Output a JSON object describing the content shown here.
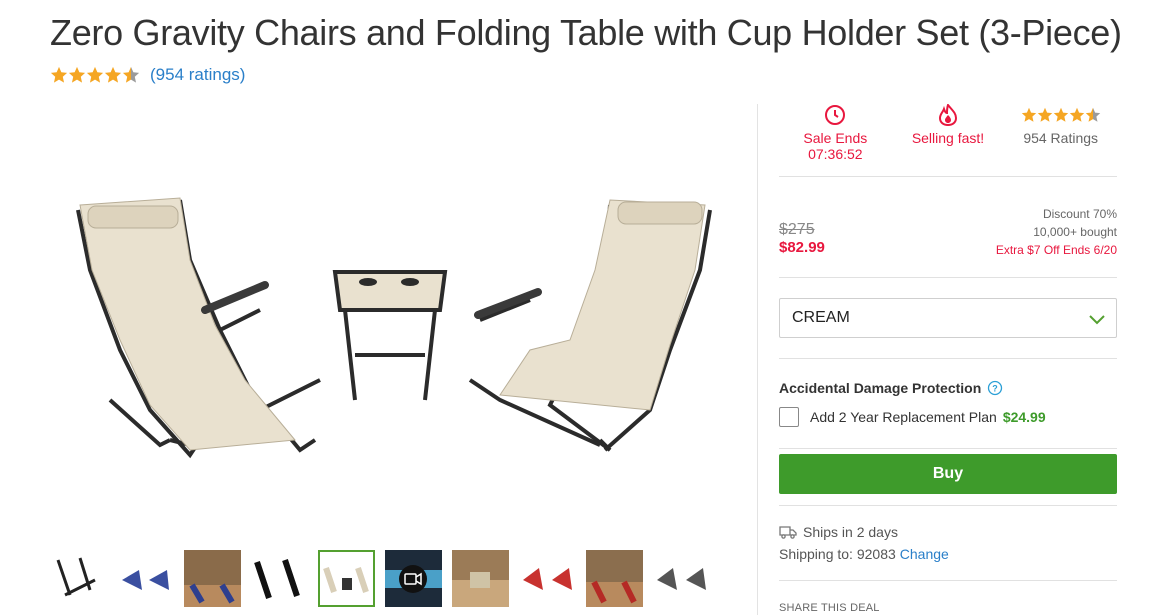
{
  "product": {
    "title": "Zero Gravity Chairs and Folding Table with Cup Holder Set (3-Piece)",
    "rating": 4.5,
    "ratings_link": "(954 ratings)"
  },
  "badges": {
    "sale_label": "Sale Ends",
    "sale_timer": "07:36:52",
    "selling_fast": "Selling fast!",
    "ratings": "954 Ratings"
  },
  "price": {
    "original": "$275",
    "sale": "$82.99",
    "discount": "Discount 70%",
    "bought": "10,000+ bought",
    "extra_off": "Extra $7 Off Ends 6/20"
  },
  "variant": {
    "selected": "CREAM"
  },
  "protection": {
    "title": "Accidental Damage Protection",
    "plan_label": "Add 2 Year Replacement Plan",
    "plan_price": "$24.99"
  },
  "actions": {
    "buy_label": "Buy"
  },
  "shipping": {
    "ships_in": "Ships in 2 days",
    "shipping_to_label": "Shipping to: 92083",
    "change_label": "Change"
  },
  "share": {
    "label": "SHARE THIS DEAL"
  },
  "thumbnails": [
    {
      "name": "thumb-1",
      "kind": "black-chairs-mixed"
    },
    {
      "name": "thumb-2",
      "kind": "blue-chairs"
    },
    {
      "name": "thumb-3",
      "kind": "blue-patio"
    },
    {
      "name": "thumb-4",
      "kind": "black-chairs"
    },
    {
      "name": "thumb-5",
      "kind": "cream-chairs",
      "selected": true
    },
    {
      "name": "thumb-6",
      "kind": "video"
    },
    {
      "name": "thumb-7",
      "kind": "table-patio"
    },
    {
      "name": "thumb-8",
      "kind": "red-chairs"
    },
    {
      "name": "thumb-9",
      "kind": "red-patio"
    },
    {
      "name": "thumb-10",
      "kind": "grey-chairs"
    }
  ],
  "colors": {
    "accent_red": "#e8173e",
    "buy_green": "#3e9b2b",
    "link_blue": "#2a7fc9",
    "star_gold": "#f5a623"
  }
}
